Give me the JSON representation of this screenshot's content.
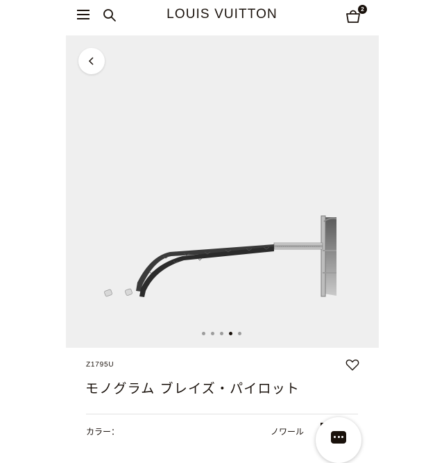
{
  "header": {
    "menu_icon": "hamburger-menu-icon",
    "search_icon": "search-icon",
    "logo": "LOUIS VUITTON",
    "bag_icon": "shopping-bag-icon",
    "bag_count": "2"
  },
  "gallery": {
    "prev_icon": "chevron-left-icon",
    "image_subject": "sunglasses-side-view",
    "slide_count": 5,
    "active_slide": 4
  },
  "product": {
    "sku": "Z1795U",
    "wishlist_icon": "heart-icon",
    "title": "モノグラム ブレイズ・パイロット",
    "color_label": "カラー：",
    "color_value": "ノワール",
    "swatch_color": "#19110b"
  },
  "chat": {
    "icon": "chat-icon"
  },
  "colors": {
    "text": "#19110b",
    "gallery_bg": "#efefef",
    "inactive_dot": "#9c9c9c"
  }
}
